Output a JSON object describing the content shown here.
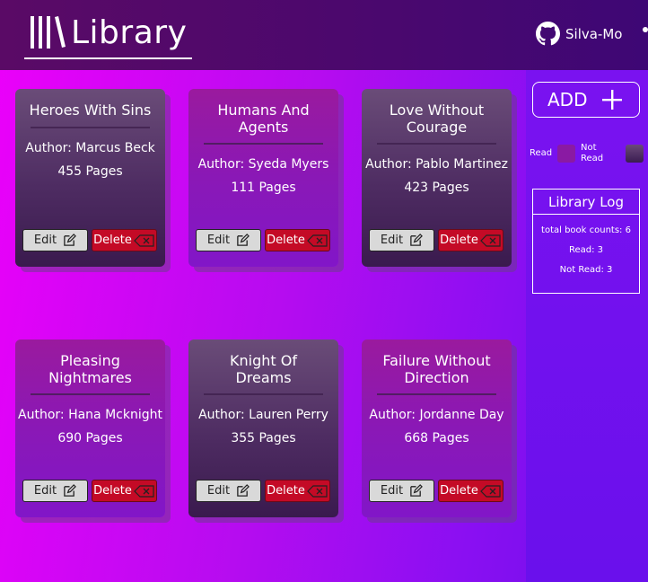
{
  "header": {
    "logo_text": "Library",
    "github_user": "Silva-Mo"
  },
  "sidebar": {
    "add_label": "ADD",
    "legend": {
      "read_label": "Read",
      "not_read_label": "Not Read"
    },
    "log": {
      "title": "Library Log",
      "total": "total book counts: 6",
      "read": "Read: 3",
      "not_read": "Not Read: 3"
    }
  },
  "books": [
    {
      "title": "Heroes With Sins",
      "author": "Author: Marcus Beck",
      "pages": "455 Pages",
      "status": "not-read"
    },
    {
      "title": "Humans And Agents",
      "author": "Author: Syeda Myers",
      "pages": "111 Pages",
      "status": "read"
    },
    {
      "title": "Love Without Courage",
      "author": "Author: Pablo Martinez",
      "pages": "423 Pages",
      "status": "not-read"
    },
    {
      "title": "Pleasing Nightmares",
      "author": "Author: Hana Mcknight",
      "pages": "690 Pages",
      "status": "read"
    },
    {
      "title": "Knight Of Dreams",
      "author": "Author: Lauren Perry",
      "pages": "355 Pages",
      "status": "not-read"
    },
    {
      "title": "Failure Without Direction",
      "author": "Author: Jordanne Day",
      "pages": "668 Pages",
      "status": "read"
    }
  ],
  "buttons": {
    "edit_label": "Edit",
    "delete_label": "Delete"
  },
  "colors": {
    "read_card": "#8a18b6",
    "not_read_card": "#4e2c62",
    "delete_button": "#c40a26",
    "edit_button": "#d9d9d9"
  },
  "icons": [
    "books-icon",
    "github-icon",
    "plus-icon",
    "edit-icon",
    "backspace-icon"
  ]
}
